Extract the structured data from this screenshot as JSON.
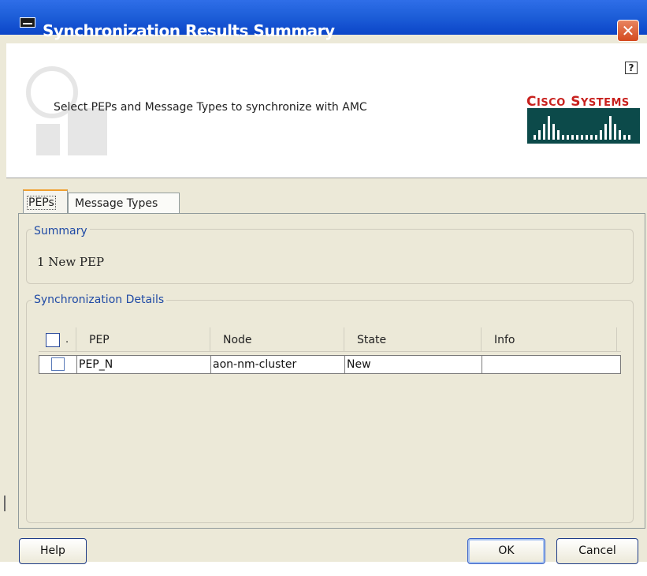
{
  "window": {
    "title": "Synchronization Results Summary",
    "close_label": "✕"
  },
  "banner": {
    "instruction": "Select PEPs and Message Types to synchronize with AMC",
    "help_icon_label": "?",
    "brand_name": "Cisco Systems",
    "brand_color": "#c8211e"
  },
  "tabs": [
    {
      "label": "PEPs",
      "selected": true
    },
    {
      "label": "Message Types",
      "selected": false
    }
  ],
  "summary": {
    "legend": "Summary",
    "text": "1 New PEP"
  },
  "details": {
    "legend": "Synchronization Details",
    "columns": [
      ".",
      "PEP",
      "Node",
      "State",
      "Info"
    ],
    "rows": [
      {
        "checked": false,
        "pep": "PEP_N",
        "node": "aon-nm-cluster",
        "state": "New",
        "info": ""
      }
    ]
  },
  "buttons": {
    "help": "Help",
    "ok": "OK",
    "cancel": "Cancel"
  },
  "colors": {
    "titlebar": "#1e5fd9",
    "dialog_bg": "#ece9d8",
    "legend_text": "#1f4aa5"
  }
}
